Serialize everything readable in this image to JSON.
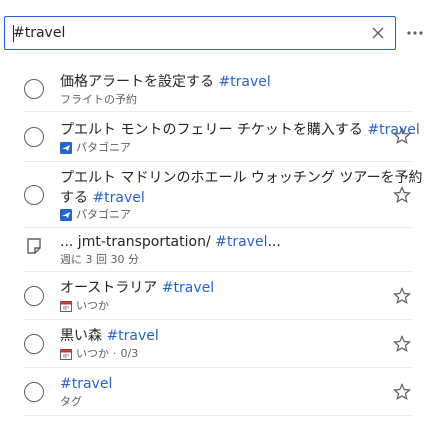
{
  "search": {
    "value": "#travel",
    "clear_icon": "close-icon",
    "more_icon": "more-horizontal-icon"
  },
  "tasks": [
    {
      "title": "価格アラートを設定する",
      "tag": "#travel",
      "meta": "フライトの予約",
      "meta_icon": "",
      "starred": false
    },
    {
      "title": "プエルト モントのフェリー チケットを購入する",
      "tag": "#travel",
      "meta": "パタゴニア",
      "meta_icon": "plane-icon",
      "starred": true
    },
    {
      "title_line1": "プエルト マドリンのホエール ウォッチング ツアーを予約",
      "title_line2": "する",
      "tag": "#travel",
      "meta": "パタゴニア",
      "meta_icon": "plane-icon",
      "starred": true
    },
    {
      "title": "... jmt-transportation/",
      "tag": "#travel",
      "suffix": "...",
      "meta": "週に 3 回 30 分",
      "meta_icon": "note-icon",
      "starred": false
    },
    {
      "title": "オーストラリア",
      "tag": "#travel",
      "meta": "いつか",
      "meta_icon": "calendar-icon",
      "starred": true
    },
    {
      "title": "黒い森",
      "tag": "#travel",
      "meta": "いつか",
      "meta_extra": "0/3",
      "meta_icon": "calendar-icon",
      "starred": true
    },
    {
      "title": "",
      "tag": "#travel",
      "meta": "タグ",
      "meta_icon": "",
      "starred": true
    }
  ],
  "colors": {
    "accent": "#2564cf",
    "text": "#252423",
    "subtle": "#605e5c"
  }
}
